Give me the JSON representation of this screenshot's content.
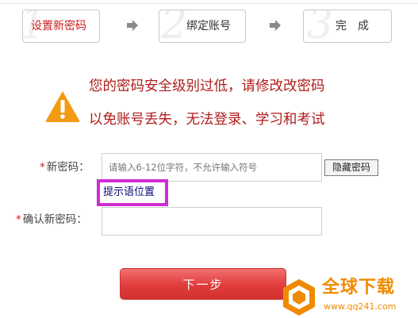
{
  "steps": [
    {
      "number": "1",
      "label": "设置新密码"
    },
    {
      "number": "2",
      "label": "绑定账号"
    },
    {
      "number": "3",
      "label": "完成"
    }
  ],
  "warning": {
    "line1": "您的密码安全级别过低，请修改改密码",
    "line2": "以免账号丢失，无法登录、学习和考试"
  },
  "form": {
    "required_mark": "*",
    "new_password_label": "新密码：",
    "new_password_placeholder": "请输入6-12位字符，不允许输入符号",
    "hide_password_button": "隐藏密码",
    "hint_text": "提示语位置",
    "confirm_password_label": "确认新密码：",
    "confirm_password_value": ""
  },
  "next_button": "下一步",
  "watermark": {
    "name": "全球下载",
    "url": "www.qq241.com"
  },
  "colors": {
    "accent_red": "#cc1c1c",
    "warning_text": "#b11c1c",
    "warning_icon": "#f29b12",
    "hint_highlight": "#d12cd4",
    "button_red": "#e03c3c",
    "watermark_orange": "#f08a00"
  }
}
